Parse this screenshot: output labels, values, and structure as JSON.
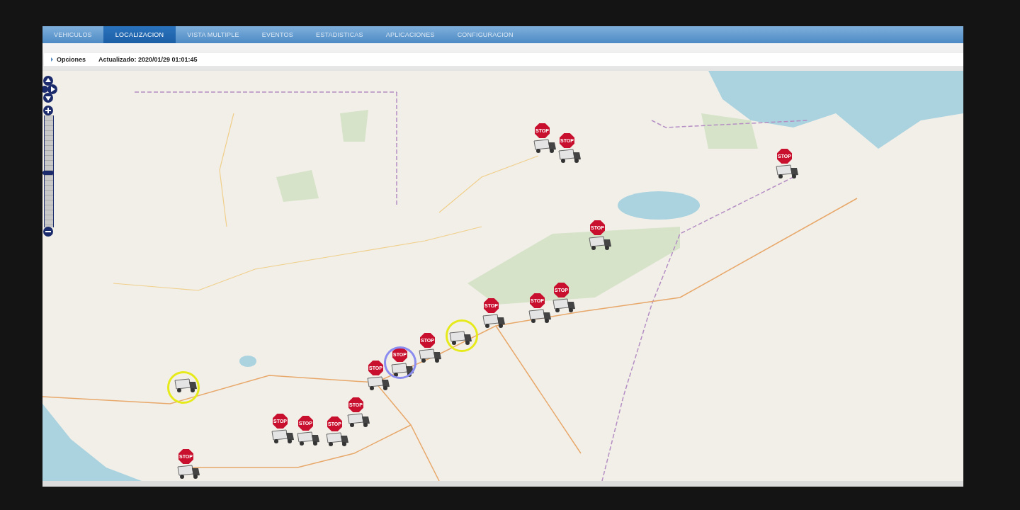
{
  "tabs": [
    {
      "label": "VEHICULOS",
      "selected": false
    },
    {
      "label": "LOCALIZACION",
      "selected": true
    },
    {
      "label": "VISTA MULTIPLE",
      "selected": false
    },
    {
      "label": "EVENTOS",
      "selected": false
    },
    {
      "label": "ESTADISTICAS",
      "selected": false
    },
    {
      "label": "APLICACIONES",
      "selected": false
    },
    {
      "label": "CONFIGURACION",
      "selected": false
    }
  ],
  "toolbar": {
    "options": "Opciones",
    "updated": "Actualizado: 2020/01/29 01:01:45"
  },
  "map": {
    "zoom": {
      "level": 0.49
    },
    "markers": [
      {
        "status": "STOP"
      },
      {
        "status": "STOP"
      },
      {
        "status": "STOP"
      },
      {
        "status": "STOP"
      },
      {
        "status": "STOP"
      },
      {
        "status": "STOP"
      },
      {
        "status": "STOP"
      },
      {
        "status": "STOP"
      },
      {
        "color": "#e6ea1a"
      },
      {
        "status": "STOP",
        "color": "#8a8cf0"
      },
      {
        "status": "STOP"
      },
      {
        "status": "STOP"
      },
      {
        "status": "STOP"
      },
      {
        "status": "STOP"
      },
      {
        "status": "STOP"
      },
      {
        "status": "STOP"
      },
      {
        "color": "#e6ea1a"
      }
    ]
  }
}
